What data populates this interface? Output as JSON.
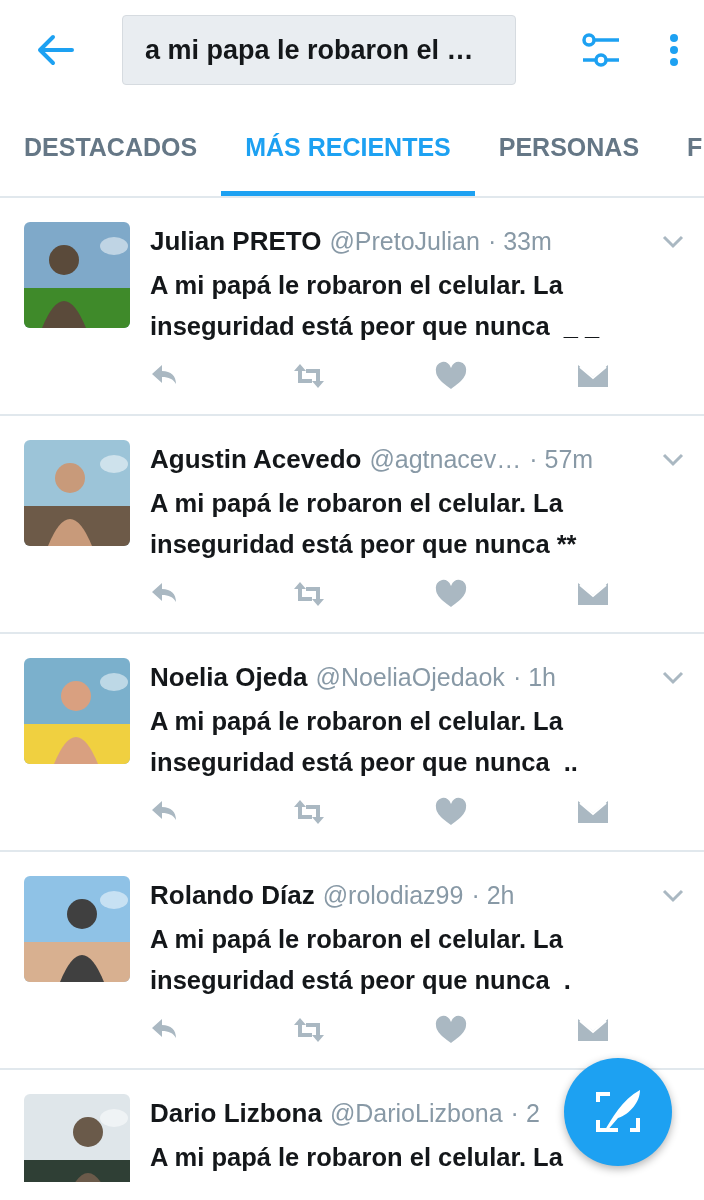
{
  "search": {
    "value": "a mi papa le robaron el …"
  },
  "tabs": [
    {
      "label": "DESTACADOS",
      "selected": false
    },
    {
      "label": "MÁS RECIENTES",
      "selected": true
    },
    {
      "label": "PERSONAS",
      "selected": false
    },
    {
      "label": "F",
      "selected": false
    }
  ],
  "tweets": [
    {
      "name": "Julian PRETO",
      "handle": "@PretoJulian",
      "time": "· 33m",
      "text": "A mi papá le robaron el celular. La inseguridad está peor que nunca  _ _"
    },
    {
      "name": "Agustin Acevedo",
      "handle": "@agtnacev…",
      "time": "· 57m",
      "text": "A mi papá le robaron el celular. La inseguridad está peor que nunca **"
    },
    {
      "name": "Noelia Ojeda",
      "handle": "@NoeliaOjedaok",
      "time": "· 1h",
      "text": "A mi papá le robaron el celular. La inseguridad está peor que nunca  .."
    },
    {
      "name": "Rolando Díaz",
      "handle": "@rolodiaz99",
      "time": "· 2h",
      "text": "A mi papá le robaron el celular. La inseguridad está peor que nunca  ."
    },
    {
      "name": "Dario Lizbona",
      "handle": "@DarioLizbona",
      "time": "· 2",
      "text": "A mi papá le robaron el celular. La",
      "chevron": false
    }
  ]
}
